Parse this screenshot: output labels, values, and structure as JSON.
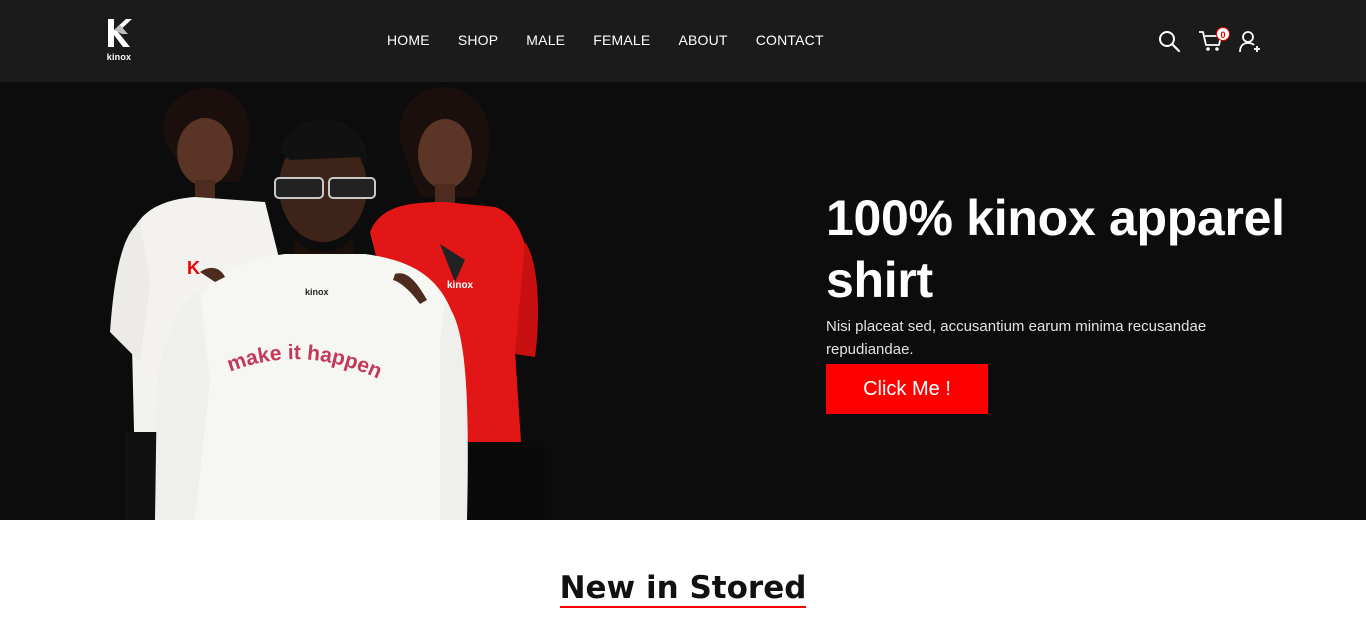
{
  "brand": {
    "name": "kinox",
    "accent": "#ff0000"
  },
  "nav": {
    "items": [
      "HOME",
      "SHOP",
      "MALE",
      "FEMALE",
      "ABOUT",
      "CONTACT"
    ]
  },
  "header_icons": {
    "search": "search-icon",
    "cart": "cart-icon",
    "cart_count": "0",
    "account": "add-user-icon"
  },
  "hero": {
    "title": "100% kinox apparel shirt",
    "subtitle": "Nisi placeat sed, accusantium earum minima recusandae repudiandae.",
    "cta_label": "Click Me !",
    "shirt_print": "make it happen",
    "shirt_brand": "kinox"
  },
  "section": {
    "title": "New in Stored"
  }
}
